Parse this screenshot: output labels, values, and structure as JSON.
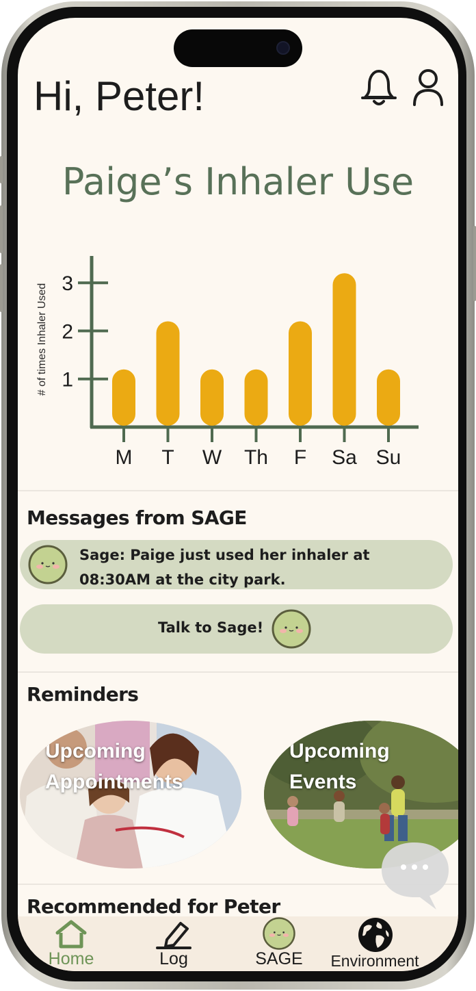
{
  "header": {
    "greeting": "Hi, Peter!",
    "bell_icon": "bell-icon",
    "profile_icon": "user-icon"
  },
  "chart_data": {
    "type": "bar",
    "title": "Paige’s Inhaler Use",
    "ylabel": "# of times Inhaler Used",
    "xlabel": "",
    "categories": [
      "M",
      "T",
      "W",
      "Th",
      "F",
      "Sa",
      "Su"
    ],
    "values": [
      1,
      2,
      1,
      1,
      2,
      3,
      1
    ],
    "yticks": [
      1,
      2,
      3
    ],
    "ylim": [
      0,
      3.9
    ],
    "bar_color": "#ebaa13",
    "axis_color": "#4f6a50",
    "grid": false
  },
  "messages": {
    "heading": "Messages from SAGE",
    "items": [
      {
        "text": "Sage: Paige just used her inhaler at 08:30AM at the city park.",
        "avatar_icon": "sage-avatar-icon"
      }
    ],
    "talk_button": "Talk to Sage!"
  },
  "reminders": {
    "heading": "Reminders",
    "cards": [
      {
        "line1": "Upcoming",
        "line2": "Appointments"
      },
      {
        "line1": "Upcoming",
        "line2": "Events"
      }
    ]
  },
  "recommended": {
    "heading": "Recommended for Peter"
  },
  "chat_fab": {
    "icon": "chat-bubble-icon"
  },
  "nav": {
    "items": [
      {
        "label": "Home",
        "icon": "home-icon",
        "active": true
      },
      {
        "label": "Log",
        "icon": "pencil-icon",
        "active": false
      },
      {
        "label": "SAGE",
        "icon": "sage-avatar-icon",
        "active": false
      },
      {
        "label": "Environment",
        "icon": "globe-icon",
        "active": false
      }
    ],
    "active_color": "#6e9457"
  },
  "colors": {
    "background": "#fdf8f1",
    "pill": "#d4dac2",
    "accent_green": "#587158",
    "bar": "#ebaa13"
  }
}
